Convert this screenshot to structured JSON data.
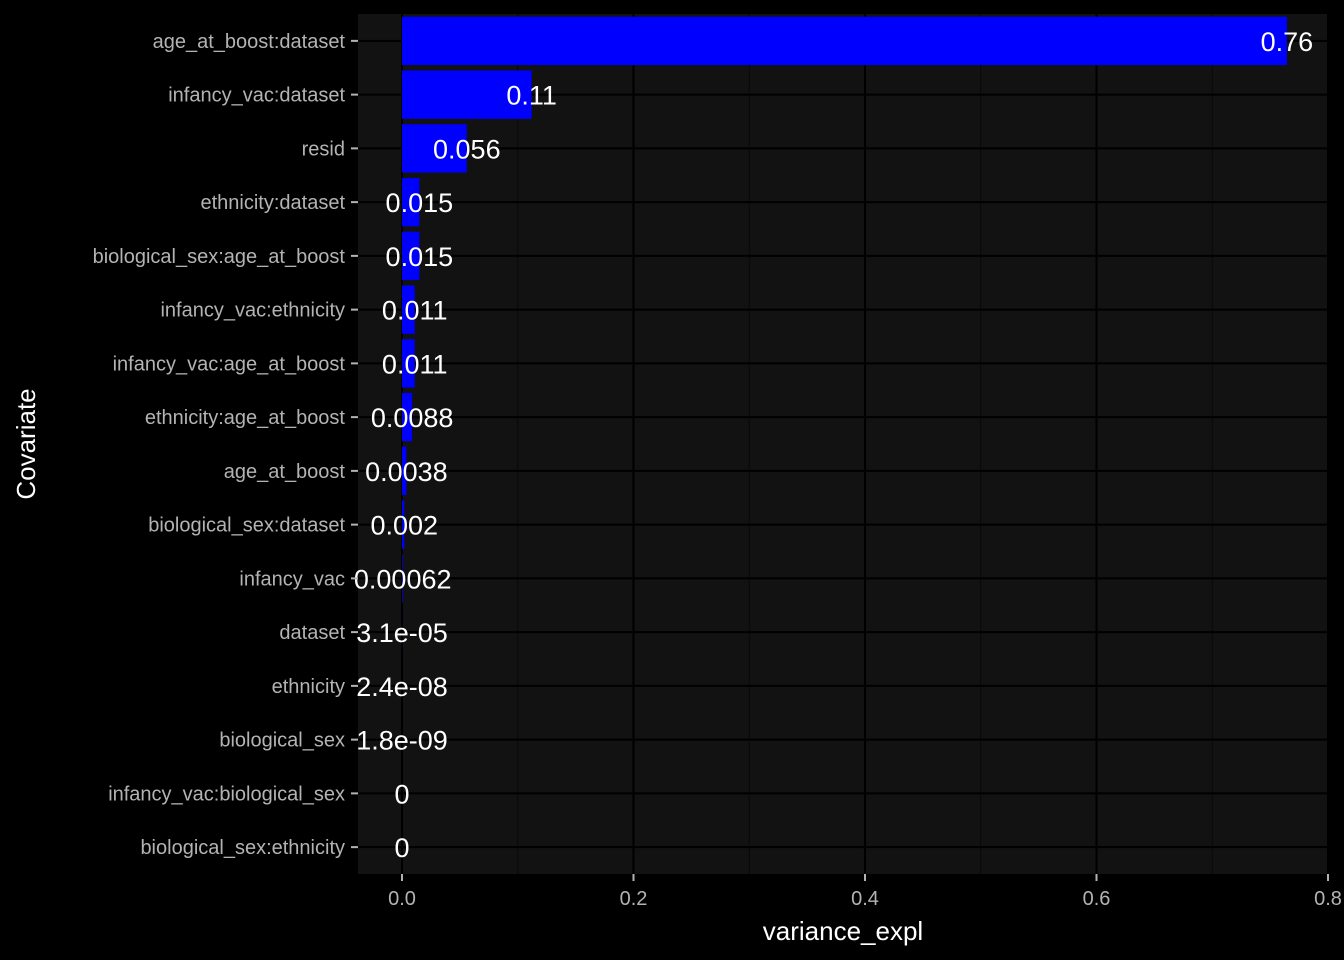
{
  "chart_data": {
    "type": "bar",
    "orientation": "horizontal",
    "categories": [
      "age_at_boost:dataset",
      "infancy_vac:dataset",
      "resid",
      "ethnicity:dataset",
      "biological_sex:age_at_boost",
      "infancy_vac:ethnicity",
      "infancy_vac:age_at_boost",
      "ethnicity:age_at_boost",
      "age_at_boost",
      "biological_sex:dataset",
      "infancy_vac",
      "dataset",
      "ethnicity",
      "biological_sex",
      "infancy_vac:biological_sex",
      "biological_sex:ethnicity"
    ],
    "values": [
      0.7645,
      0.112,
      0.056,
      0.015,
      0.015,
      0.011,
      0.011,
      0.0088,
      0.0038,
      0.002,
      0.00062,
      3.1e-05,
      2.4e-08,
      1.8e-09,
      0,
      0
    ],
    "value_labels": [
      "0.76",
      "0.11",
      "0.056",
      "0.015",
      "0.015",
      "0.011",
      "0.011",
      "0.0088",
      "0.0038",
      "0.002",
      "0.00062",
      "3.1e-05",
      "2.4e-08",
      "1.8e-09",
      "0",
      "0"
    ],
    "xlabel": "variance_expl",
    "ylabel": "Covariate",
    "xlim": [
      -0.038,
      0.8
    ],
    "xticks": [
      0.0,
      0.2,
      0.4,
      0.6,
      0.8
    ],
    "xtick_labels": [
      "0.0",
      "0.2",
      "0.4",
      "0.6",
      "0.8"
    ],
    "bar_color": "#0000ff",
    "panel_color": "#121212",
    "grid": true
  }
}
